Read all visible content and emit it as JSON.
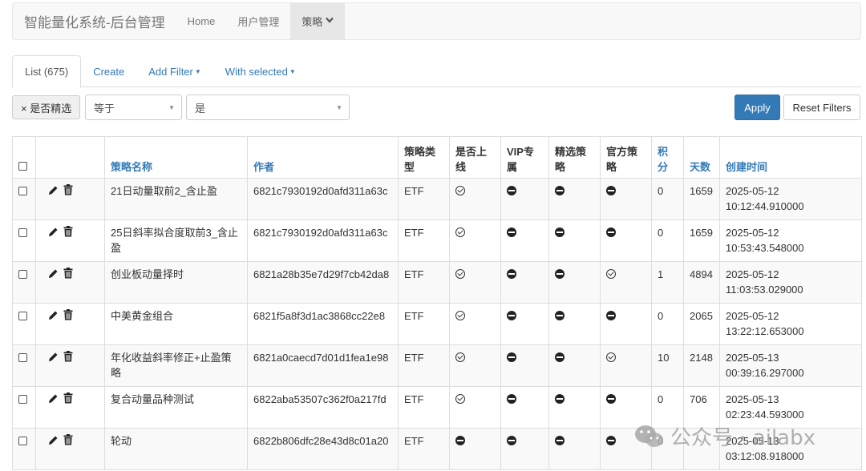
{
  "navbar": {
    "brand": "智能量化系统-后台管理",
    "items": [
      {
        "label": "Home"
      },
      {
        "label": "用户管理"
      },
      {
        "label": "策略",
        "active": true
      }
    ]
  },
  "tabs": [
    {
      "label": "List (675)",
      "active": true
    },
    {
      "label": "Create"
    },
    {
      "label": "Add Filter",
      "dropdown": true
    },
    {
      "label": "With selected",
      "dropdown": true
    }
  ],
  "filter": {
    "remove_label": "× 是否精选",
    "operator": "等于",
    "value": "是",
    "apply_label": "Apply",
    "reset_label": "Reset Filters"
  },
  "table": {
    "headers": {
      "name": "策略名称",
      "author": "作者",
      "type": "策略类型",
      "online": "是否上线",
      "vip": "VIP专属",
      "featured": "精选策略",
      "official": "官方策略",
      "points": "积分",
      "days": "天数",
      "created": "创建时间"
    },
    "rows": [
      {
        "name": "21日动量取前2_含止盈",
        "author": "6821c7930192d0afd311a63c",
        "type": "ETF",
        "online": "check",
        "vip": "minus",
        "featured": "minus",
        "official": "minus",
        "points": "0",
        "days": "1659",
        "created": "2025-05-12 10:12:44.910000"
      },
      {
        "name": "25日斜率拟合度取前3_含止盈",
        "author": "6821c7930192d0afd311a63c",
        "type": "ETF",
        "online": "check",
        "vip": "minus",
        "featured": "minus",
        "official": "minus",
        "points": "0",
        "days": "1659",
        "created": "2025-05-12 10:53:43.548000"
      },
      {
        "name": "创业板动量择时",
        "author": "6821a28b35e7d29f7cb42da8",
        "type": "ETF",
        "online": "check",
        "vip": "minus",
        "featured": "minus",
        "official": "check",
        "points": "1",
        "days": "4894",
        "created": "2025-05-12 11:03:53.029000"
      },
      {
        "name": "中美黄金组合",
        "author": "6821f5a8f3d1ac3868cc22e8",
        "type": "ETF",
        "online": "check",
        "vip": "minus",
        "featured": "minus",
        "official": "minus",
        "points": "0",
        "days": "2065",
        "created": "2025-05-12 13:22:12.653000"
      },
      {
        "name": "年化收益斜率修正+止盈策略",
        "author": "6821a0caecd7d01d1fea1e98",
        "type": "ETF",
        "online": "check",
        "vip": "minus",
        "featured": "minus",
        "official": "check",
        "points": "10",
        "days": "2148",
        "created": "2025-05-13 00:39:16.297000"
      },
      {
        "name": "复合动量品种测试",
        "author": "6822aba53507c362f0a217fd",
        "type": "ETF",
        "online": "check",
        "vip": "minus",
        "featured": "minus",
        "official": "minus",
        "points": "0",
        "days": "706",
        "created": "2025-05-13 02:23:44.593000"
      },
      {
        "name": "轮动",
        "author": "6822b806dfc28e43d8c01a20",
        "type": "ETF",
        "online": "minus",
        "vip": "minus",
        "featured": "minus",
        "official": "minus",
        "points": "0",
        "days": "",
        "created": "2025-05-13 03:12:08.918000"
      }
    ]
  },
  "watermark": {
    "text": "公众号 · ailabx"
  },
  "colors": {
    "link": "#337ab7",
    "primary": "#337ab7",
    "navbar_bg": "#f8f8f8",
    "stripe": "#f9f9f9"
  }
}
